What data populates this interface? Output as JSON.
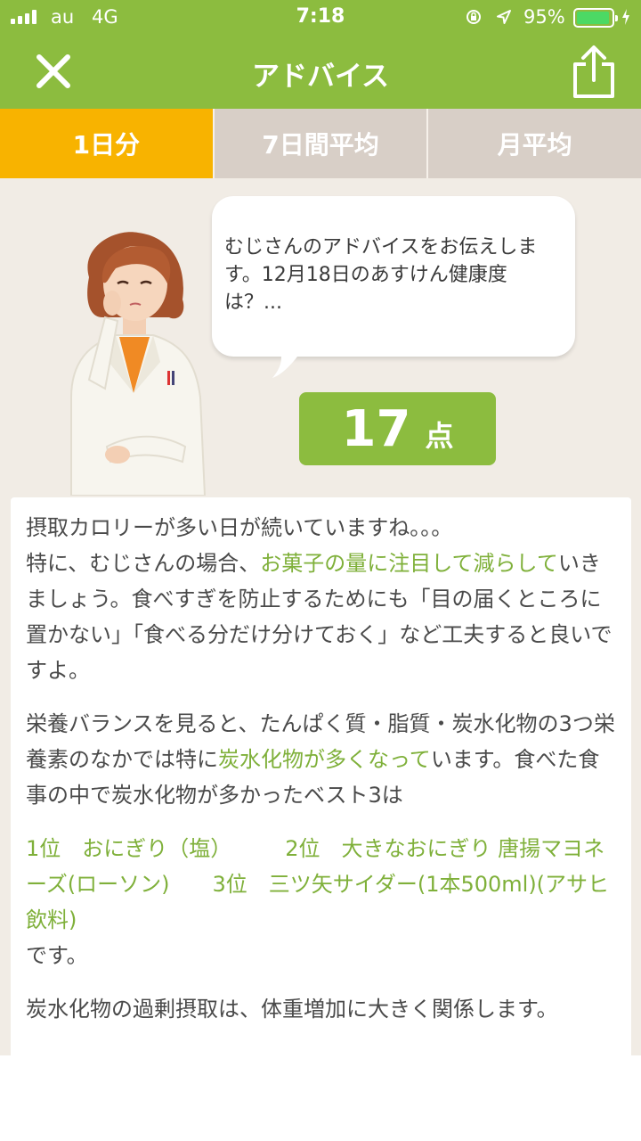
{
  "status_bar": {
    "carrier": "au",
    "network": "4G",
    "time": "7:18",
    "battery_percent": "95%",
    "battery_level": 0.95
  },
  "nav": {
    "title": "アドバイス",
    "close_icon": "close-icon",
    "share_icon": "share-icon"
  },
  "tabs": [
    {
      "label": "1日分",
      "active": true
    },
    {
      "label": "7日間平均",
      "active": false
    },
    {
      "label": "月平均",
      "active": false
    }
  ],
  "advisor": {
    "bubble_text": "むじさんのアドバイスをお伝えします。12月18日のあすけん健康度は？...",
    "score_value": "17",
    "score_unit": "点"
  },
  "advice": {
    "p1_a": "摂取カロリーが多い日が続いていますね。。。",
    "p1_b": "特に、むじさんの場合、",
    "p1_hl": "お菓子の量に注目して減らして",
    "p1_c": "いきましょう。食べすぎを防止するためにも「目の届くところに置かない」「食べる分だけ分けておく」など工夫すると良いですよ。",
    "p2_a": "栄養バランスを見ると、たんぱく質・脂質・炭水化物の3つ栄養素のなかでは特に",
    "p2_hl": "炭水化物が多くなって",
    "p2_b": "います。食べた食事の中で炭水化物が多かったベスト3は",
    "ranking": "1位　おにぎり（塩）　　　2位　大きなおにぎり 唐揚マヨネーズ(ローソン)　　3位　三ツ矢サイダー(1本500ml)(アサヒ飲料)",
    "ranking_suffix": "です。",
    "partial_line": "炭水化物の過剰摂取は、体重増加に大きく関係します。"
  },
  "colors": {
    "brand_green": "#8cbc3f",
    "tab_active": "#f8b300",
    "tab_inactive": "#d8cfc7",
    "highlight": "#7fb03a"
  }
}
